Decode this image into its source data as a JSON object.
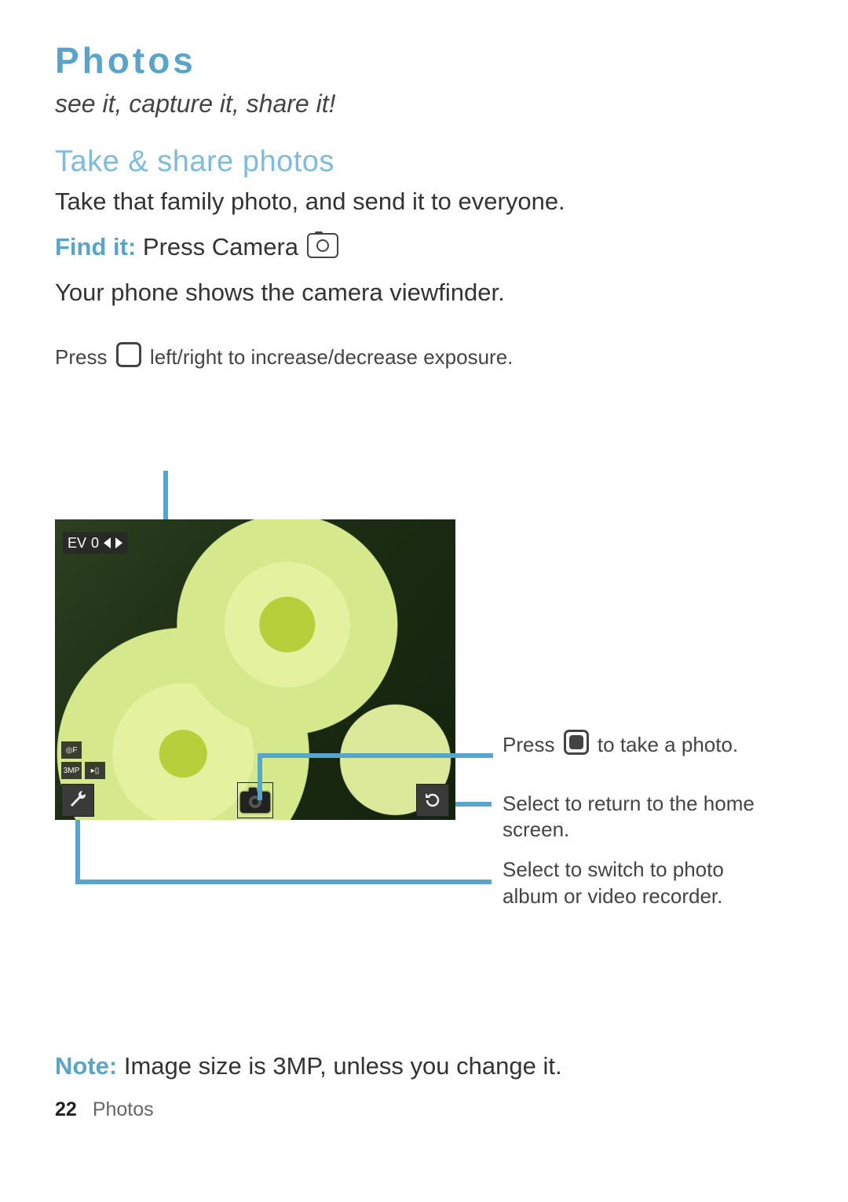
{
  "title": "Photos",
  "subtitle": "see it, capture it, share it!",
  "section_heading": "Take & share photos",
  "intro_text": "Take that family photo, and send it to everyone.",
  "find_it_label": "Find it:",
  "find_it_text_before_icon": " Press Camera ",
  "viewfinder_text": "Your phone shows the camera viewfinder.",
  "callouts": {
    "exposure_before": "Press ",
    "exposure_after": " left/right to increase/decrease exposure.",
    "take_photo_before": "Press ",
    "take_photo_after": " to take a photo.",
    "return_home": "Select to return to the home screen.",
    "switch_mode": "Select to switch to photo album or video recorder."
  },
  "viewfinder": {
    "ev_label": "EV",
    "ev_value": "0",
    "side_icons": {
      "focus_mode": "F",
      "resolution": "3MP",
      "storage": "▯"
    },
    "toolbar": {
      "tools": "wrench-icon",
      "shutter": "camera-icon",
      "back": "return-icon"
    }
  },
  "note_label": "Note:",
  "note_text": " Image size is 3MP, unless you change it.",
  "footer": {
    "page_number": "22",
    "section": "Photos"
  },
  "colors": {
    "accent": "#5aa3c9"
  }
}
